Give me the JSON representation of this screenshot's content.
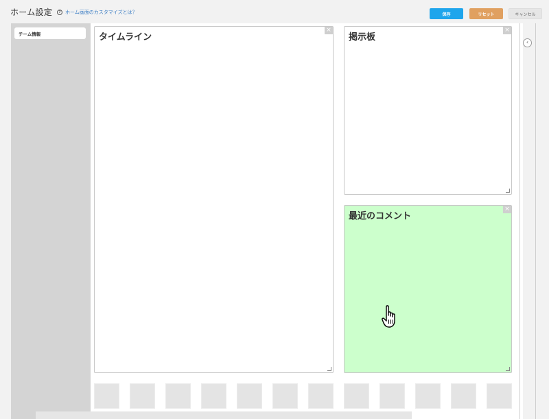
{
  "header": {
    "title": "ホーム設定",
    "help_link": "ホーム画面のカスタマイズとは？",
    "help_icon_glyph": "?",
    "buttons": {
      "save": "保存",
      "reset": "リセット",
      "cancel": "キャンセル"
    }
  },
  "sidebar": {
    "items": [
      {
        "label": "チーム情報"
      }
    ]
  },
  "widgets": {
    "timeline": {
      "title": "タイムライン",
      "close_glyph": "×"
    },
    "board": {
      "title": "掲示板",
      "close_glyph": "×"
    },
    "comments": {
      "title": "最近のコメント",
      "close_glyph": "×",
      "highlight_color": "#ccffcc"
    }
  },
  "rail": {
    "collapse_glyph": "‹"
  },
  "colors": {
    "save": "#1ea5ec",
    "reset": "#e0a060",
    "cancel": "#e6e6e6",
    "sidebar": "#d4d4d4"
  }
}
